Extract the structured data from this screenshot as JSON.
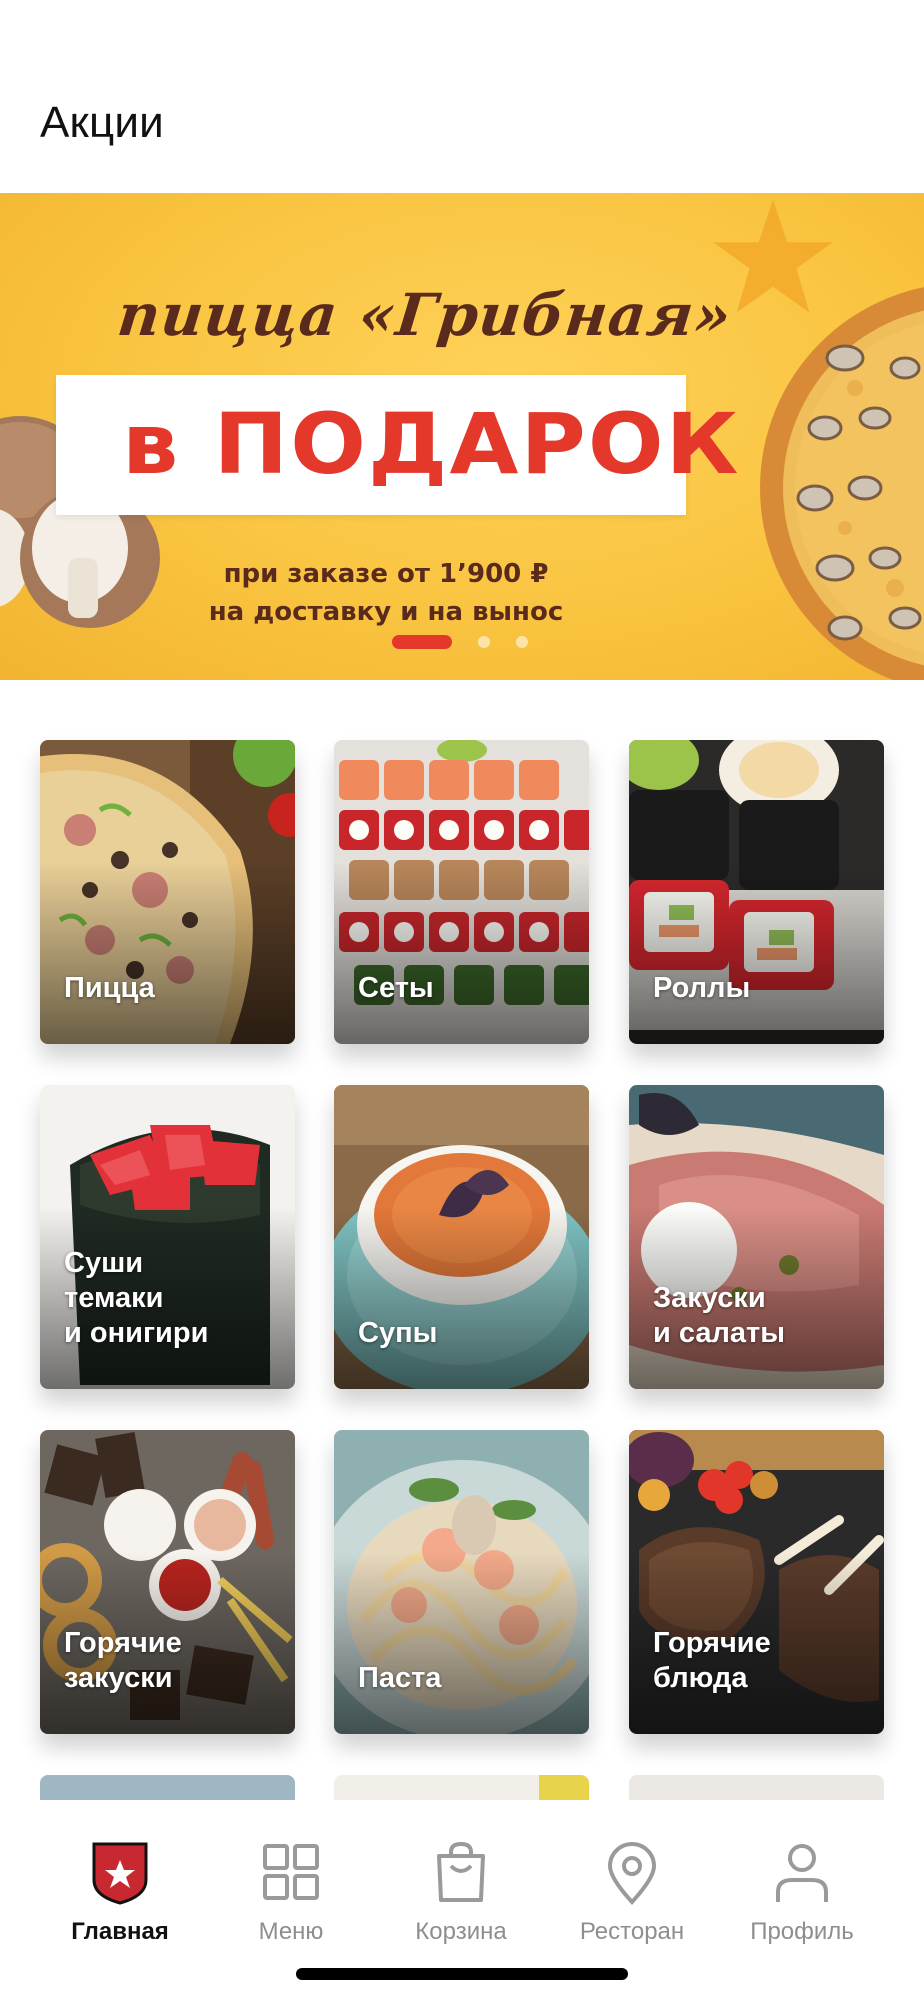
{
  "header": {
    "title": "Акции"
  },
  "banner": {
    "headline": "пицца «Грибная»",
    "highlight": "в ПОДАРОК",
    "subtitle_line1": "при заказе от 1’900 ₽",
    "subtitle_line2": "на доставку и на вынос",
    "slides_total": 3,
    "active_slide": 1,
    "colors": {
      "background": "#f9c440",
      "headline": "#5a2a1c",
      "highlight": "#e4382b"
    }
  },
  "categories": [
    {
      "label": "Пицца"
    },
    {
      "label": "Сеты"
    },
    {
      "label": "Роллы"
    },
    {
      "label": "Суши\nтемаки\nи онигири"
    },
    {
      "label": "Супы"
    },
    {
      "label": "Закуски\nи салаты"
    },
    {
      "label": "Горячие\nзакуски"
    },
    {
      "label": "Паста"
    },
    {
      "label": "Горячие\nблюда"
    }
  ],
  "bottom_nav": {
    "items": [
      {
        "label": "Главная",
        "icon": "shield-star-icon",
        "active": true
      },
      {
        "label": "Меню",
        "icon": "grid-icon",
        "active": false
      },
      {
        "label": "Корзина",
        "icon": "bag-icon",
        "active": false
      },
      {
        "label": "Ресторан",
        "icon": "location-pin-icon",
        "active": false
      },
      {
        "label": "Профиль",
        "icon": "person-icon",
        "active": false
      }
    ],
    "accent_color": "#c8282f"
  }
}
